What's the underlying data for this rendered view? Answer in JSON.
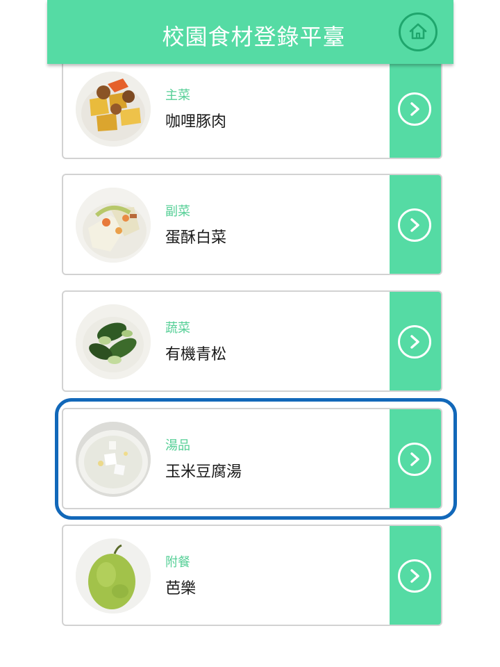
{
  "header": {
    "title": "校園食材登錄平臺",
    "home_icon": "home-icon"
  },
  "colors": {
    "accent": "#55dba4",
    "accent_dark": "#1fa66d",
    "category_text": "#55cf96",
    "highlight": "#1268b9"
  },
  "menu": [
    {
      "category": "主菜",
      "dish": "咖哩豚肉",
      "image": "curry-pork-photo"
    },
    {
      "category": "副菜",
      "dish": "蛋酥白菜",
      "image": "cabbage-photo"
    },
    {
      "category": "蔬菜",
      "dish": "有機青松",
      "image": "greens-photo"
    },
    {
      "category": "湯品",
      "dish": "玉米豆腐湯",
      "image": "soup-photo"
    },
    {
      "category": "附餐",
      "dish": "芭樂",
      "image": "guava-photo"
    }
  ]
}
